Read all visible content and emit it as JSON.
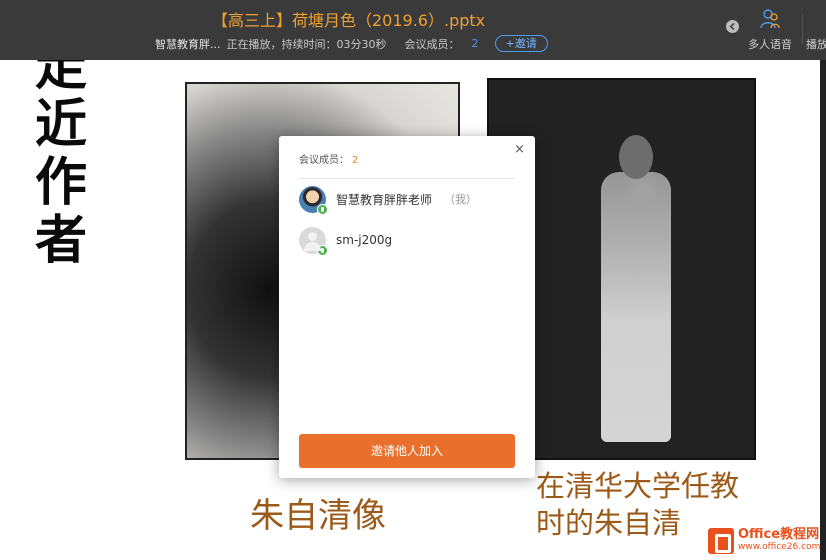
{
  "topbar": {
    "doc_title": "【高三上】荷塘月色（2019.6）.pptx",
    "presenter": "智慧教育胖...",
    "status": "正在播放，持续时间：03分30秒",
    "members_label": "会议成员：",
    "members_count": "2",
    "invite_label": "+邀请",
    "multi_voice_label": "多人语音",
    "cut_label": "播放"
  },
  "slide": {
    "vertical_title": [
      "走",
      "近",
      "作",
      "者"
    ],
    "caption_left": "朱自清像",
    "caption_right": "在清华大学任教时的朱自清"
  },
  "popup": {
    "title": "会议成员：",
    "count": "2",
    "close_glyph": "×",
    "members": [
      {
        "name": "智慧教育胖胖老师",
        "tag": "（我）"
      },
      {
        "name": "sm-j200g",
        "tag": ""
      }
    ],
    "invite_button": "邀请他人加入"
  },
  "watermark": {
    "main": "Office教程网",
    "sub": "www.office26.com"
  },
  "colors": {
    "topbar_bg": "#3a3a3a",
    "title_orange": "#f0a030",
    "accent_blue": "#4a9cf0",
    "caption_brown": "#9c5a18",
    "button_orange": "#e8702c"
  }
}
